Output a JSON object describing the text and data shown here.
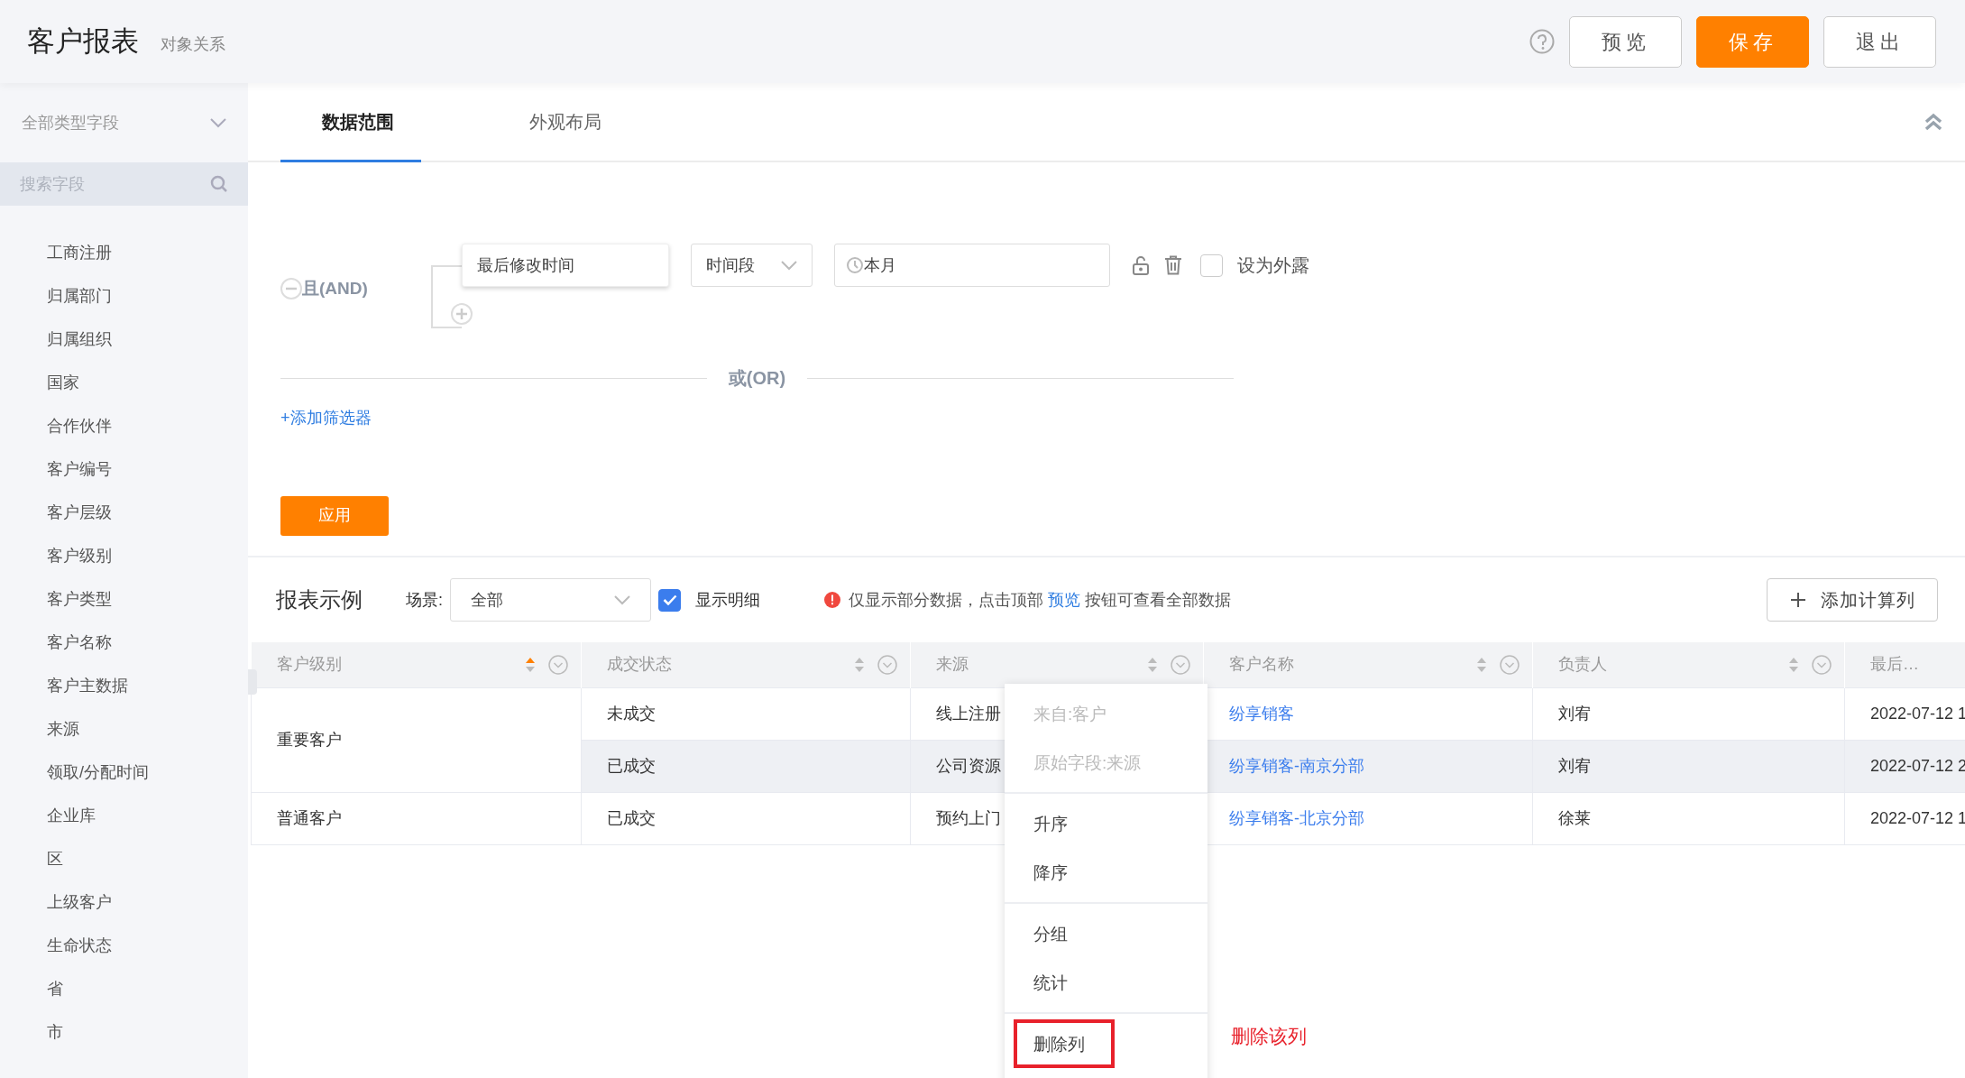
{
  "header": {
    "title": "客户报表",
    "subtitle": "对象关系",
    "buttons": [
      {
        "label": "预览",
        "kind": "default"
      },
      {
        "label": "保存",
        "kind": "primary"
      },
      {
        "label": "退出",
        "kind": "default"
      }
    ]
  },
  "sidebar": {
    "type_select": "全部类型字段",
    "search": {
      "placeholder": "搜索字段"
    },
    "items": [
      "工商注册",
      "归属部门",
      "归属组织",
      "国家",
      "合作伙伴",
      "客户编号",
      "客户层级",
      "客户级别",
      "客户类型",
      "客户名称",
      "客户主数据",
      "来源",
      "领取/分配时间",
      "企业库",
      "区",
      "上级客户",
      "生命状态",
      "省",
      "市"
    ]
  },
  "tabs": [
    {
      "label": "数据范围",
      "selected": true
    },
    {
      "label": "外观布局",
      "selected": false
    }
  ],
  "filter": {
    "group_label": "且(AND)",
    "conditions": [
      {
        "field": "最后修改时间",
        "operator": "时间段",
        "value": "本月",
        "expose_label": "设为外露",
        "exposed": false
      }
    ],
    "or_label": "或(OR)",
    "add_filter": "+添加筛选器",
    "apply": "应用"
  },
  "report": {
    "title": "报表示例",
    "scene_label": "场景:",
    "scene_value": "全部",
    "show_detail": {
      "label": "显示明细",
      "checked": true
    },
    "notice": {
      "before": "仅显示部分数据，点击顶部",
      "link": "预览",
      "after": "按钮可查看全部数据"
    },
    "add_column": "添加计算列",
    "columns": [
      {
        "label": "客户级别",
        "sorted_ascending": true
      },
      {
        "label": "成交状态",
        "sorted_ascending": false
      },
      {
        "label": "来源",
        "sorted_ascending": false
      },
      {
        "label": "客户名称",
        "sorted_ascending": false
      },
      {
        "label": "负责人",
        "sorted_ascending": false
      },
      {
        "label": "最后…"
      }
    ],
    "groups": [
      {
        "level": "重要客户",
        "records": [
          {
            "status": "未成交",
            "source": "线上注册",
            "customer": "纷享销客",
            "owner": "刘宥",
            "time": "2022-07-12 1",
            "hovered": false
          },
          {
            "status": "已成交",
            "source": "公司资源",
            "customer": "纷享销客-南京分部",
            "owner": "刘宥",
            "time": "2022-07-12 2",
            "hovered": true
          }
        ]
      },
      {
        "level": "普通客户",
        "records": [
          {
            "status": "已成交",
            "source": "预约上门",
            "customer": "纷享销客-北京分部",
            "owner": "徐莱",
            "time": "2022-07-12 1",
            "hovered": false
          }
        ]
      }
    ]
  },
  "context_menu": {
    "sections": [
      [
        {
          "label": "来自:客户",
          "disabled": true,
          "marked": false
        },
        {
          "label": "原始字段:来源",
          "disabled": true,
          "marked": false
        }
      ],
      [
        {
          "label": "升序",
          "disabled": false,
          "marked": false
        },
        {
          "label": "降序",
          "disabled": false,
          "marked": false
        }
      ],
      [
        {
          "label": "分组",
          "disabled": false,
          "marked": false
        },
        {
          "label": "统计",
          "disabled": false,
          "marked": false
        }
      ],
      [
        {
          "label": "删除列",
          "disabled": false,
          "marked": true
        }
      ]
    ]
  },
  "annotation": "删除该列"
}
